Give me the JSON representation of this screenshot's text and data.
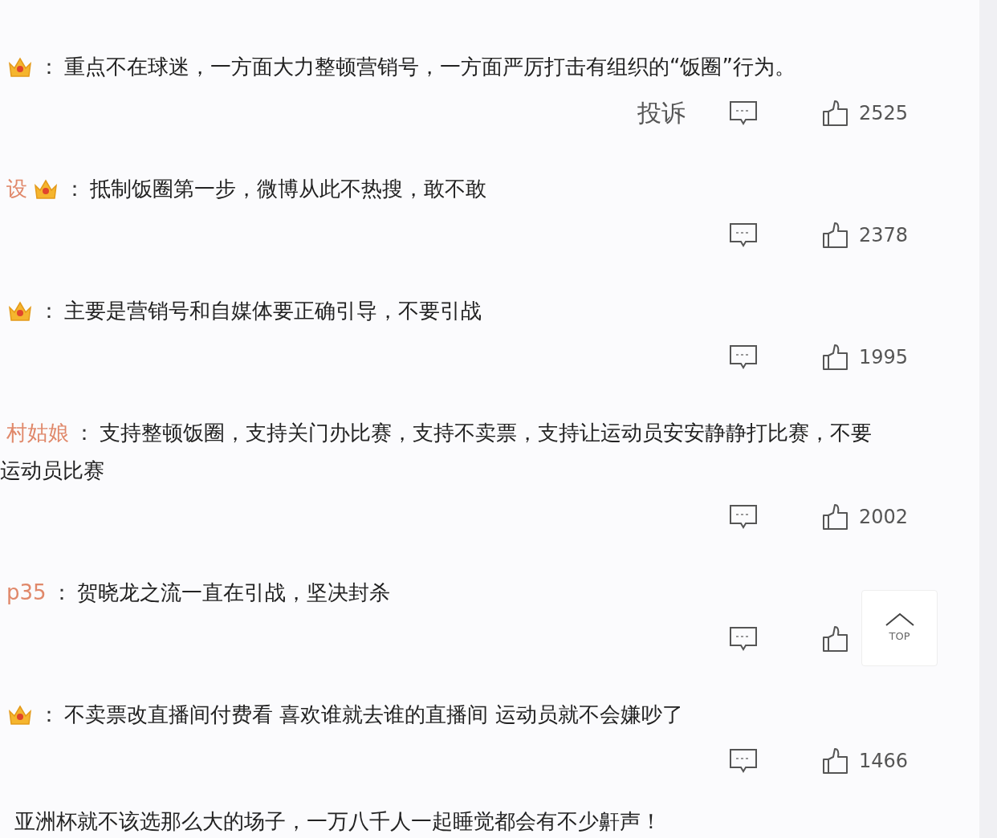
{
  "comments": [
    {
      "kind": "full",
      "badge": true,
      "separator": "：",
      "text": "重点不在球迷，一方面大力整顿营销号，一方面严厉打击有组织的“饭圈”行为。",
      "report": "投诉",
      "like_count": "2525"
    },
    {
      "kind": "full",
      "username": "设",
      "badge": true,
      "separator": "：",
      "text": "抵制饭圈第一步，微博从此不热搜，敢不敢",
      "like_count": "2378"
    },
    {
      "kind": "full",
      "badge": true,
      "separator": "：",
      "text": "主要是营销号和自媒体要正确引导，不要引战",
      "like_count": "1995"
    },
    {
      "kind": "full",
      "username": "村姑娘",
      "badge": false,
      "separator": "：",
      "text": "支持整顿饭圈，支持关门办比赛，支持不卖票，支持让运动员安安静静打比赛，不要",
      "continuation": "运动员比赛",
      "like_count": "2002"
    },
    {
      "kind": "full",
      "username": "p35",
      "badge": false,
      "separator": "：",
      "text": "贺晓龙之流一直在引战，坚决封杀"
    },
    {
      "kind": "full",
      "badge": true,
      "separator": "：",
      "text": "不卖票改直播间付费看 喜欢谁就去谁的直播间 运动员就不会嫌吵了",
      "like_count": "1466"
    },
    {
      "kind": "partial",
      "text": "亚洲杯就不该选那么大的场子，一万八千人一起睡觉都会有不少鼾声！"
    }
  ],
  "back_to_top": {
    "label": "TOP"
  }
}
